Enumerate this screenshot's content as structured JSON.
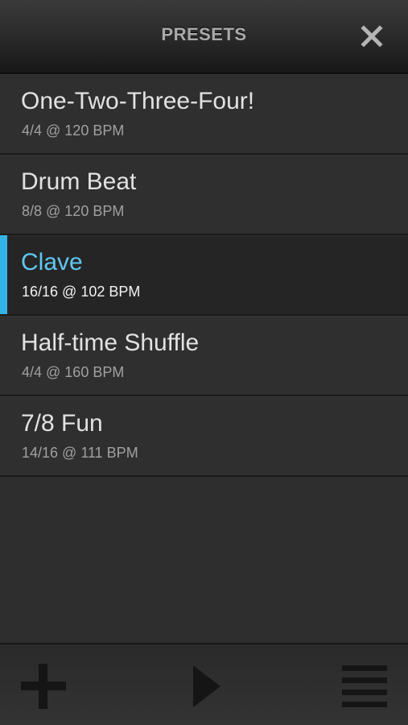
{
  "header": {
    "title": "PRESETS",
    "close_icon": "close-icon"
  },
  "presets": [
    {
      "name": "One-Two-Three-Four!",
      "meter": "4/4 @ 120 BPM",
      "selected": false
    },
    {
      "name": "Drum Beat",
      "meter": "8/8 @ 120 BPM",
      "selected": false
    },
    {
      "name": "Clave",
      "meter": "16/16 @ 102 BPM",
      "selected": true
    },
    {
      "name": "Half-time Shuffle",
      "meter": "4/4 @ 160 BPM",
      "selected": false
    },
    {
      "name": "7/8 Fun",
      "meter": "14/16 @ 111 BPM",
      "selected": false
    }
  ],
  "footer": {
    "add_icon": "plus-icon",
    "play_icon": "play-icon",
    "menu_icon": "menu-icon"
  },
  "colors": {
    "accent": "#35b3e6",
    "selected_title": "#5fc8f2",
    "background": "#2e2e2e"
  }
}
